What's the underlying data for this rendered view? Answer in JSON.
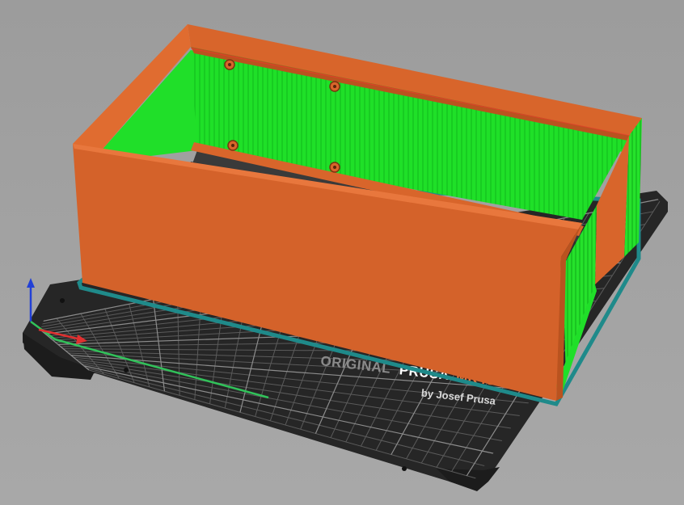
{
  "viewport": {
    "background": "#a1a1a1"
  },
  "bed": {
    "brand_prefix": "ORIGINAL",
    "brand_name": "PRUSA",
    "model": "MK4S",
    "byline": "by Josef Prusa",
    "colors": {
      "plate": "#2b2b2b",
      "grid": "#5a5a5a",
      "grid_major": "#8a8a8a",
      "model_accent": "#e8743a"
    }
  },
  "object": {
    "colors": {
      "wall_orange": "#d8652b",
      "wall_orange_dark": "#b9531f",
      "overhang_green": "#22e12a",
      "outline_teal": "#1f8a8a"
    }
  },
  "axes": {
    "x_color": "#e03030",
    "y_color": "#31c25a",
    "z_color": "#2240d6"
  }
}
